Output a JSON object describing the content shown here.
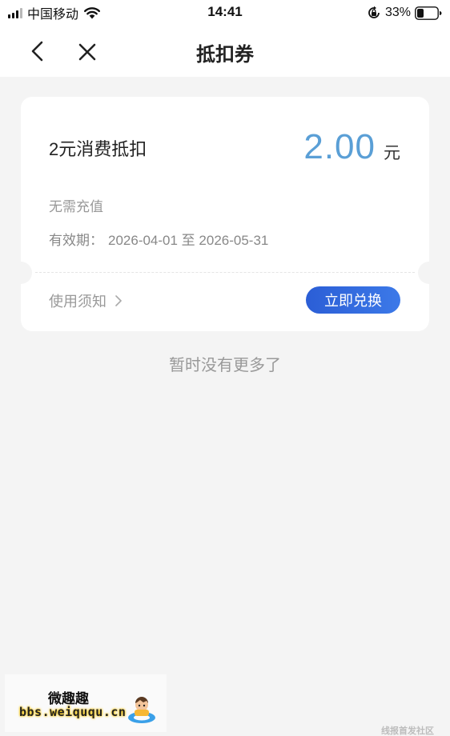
{
  "status_bar": {
    "carrier": "中国移动",
    "time": "14:41",
    "battery": "33%",
    "battery_level": 0.33
  },
  "nav": {
    "title": "抵扣券"
  },
  "coupon": {
    "name": "2元消费抵扣",
    "amount": "2.00",
    "unit": "元",
    "description": "无需充值",
    "validity_label": "有效期：",
    "validity_range": "2026-04-01 至 2026-05-31",
    "usage_notes": "使用须知",
    "redeem_label": "立即兑换"
  },
  "list": {
    "end_message": "暂时没有更多了"
  },
  "watermark": {
    "title": "微趣趣",
    "url": "bbs.weiququ.cn",
    "corner_text": "线报首发社区"
  }
}
